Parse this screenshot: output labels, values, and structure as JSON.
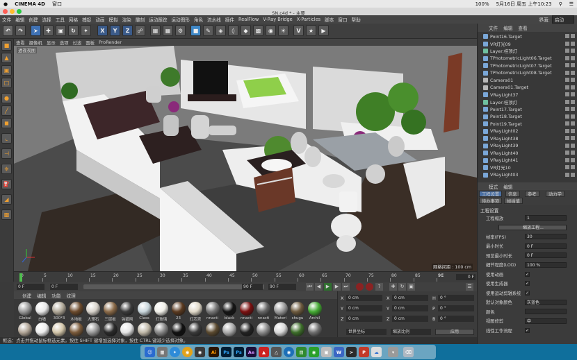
{
  "mac": {
    "app": "CINEMA 4D",
    "window_menu": "窗口",
    "battery": "100%",
    "date": "5月16日 周五 上午10:23"
  },
  "window": {
    "title": "SN.c4d * - 主要",
    "layout_label": "界面:",
    "layout_value": "启动"
  },
  "menu": [
    "文件",
    "编辑",
    "创建",
    "选择",
    "工具",
    "网格",
    "捕捉",
    "动画",
    "模拟",
    "渲染",
    "雕刻",
    "运动跟踪",
    "运动图形",
    "角色",
    "流水线",
    "插件",
    "RealFlow",
    "V-Ray Bridge",
    "X-Particles",
    "脚本",
    "窗口",
    "帮助"
  ],
  "toolbar": {
    "x": "X",
    "y": "Y",
    "z": "Z"
  },
  "viewport": {
    "menu": [
      "查看",
      "摄像机",
      "显示",
      "选项",
      "过滤",
      "面板",
      "ProRender"
    ],
    "label": "透视视图",
    "grid_info": "网格间距 : 100 cm"
  },
  "timeline": {
    "ticks": [
      "0",
      "5",
      "10",
      "15",
      "20",
      "25",
      "30",
      "35",
      "40",
      "45",
      "50",
      "55",
      "60",
      "65",
      "70",
      "75",
      "80",
      "85",
      "90"
    ],
    "end_marker": "9C",
    "frame_field": "0 F"
  },
  "playbar": {
    "start": "0 F",
    "current": "0 F",
    "end": "90 F",
    "max": "90 F"
  },
  "materials": {
    "menu": [
      "创建",
      "编辑",
      "功能",
      "纹理"
    ],
    "items": [
      {
        "label": "Global",
        "color": "#9a9a9a"
      },
      {
        "label": "白墙",
        "color": "#e8e8e8"
      },
      {
        "label": "300*3",
        "color": "#b0a898"
      },
      {
        "label": "木地板",
        "color": "#6b4a2c"
      },
      {
        "label": "大理石",
        "color": "#d8d3cb"
      },
      {
        "label": "三层板",
        "color": "#8a6a48"
      },
      {
        "label": "強碧网",
        "color": "#3b3b3b"
      },
      {
        "label": "Class",
        "color": "#c9d6dc"
      },
      {
        "label": "灯玻璃",
        "color": "#f0efe8"
      },
      {
        "label": "23",
        "color": "#5a3a20"
      },
      {
        "label": "灯芯壳",
        "color": "#e0d9c9"
      },
      {
        "label": "nnacti",
        "color": "#777777"
      },
      {
        "label": "black",
        "color": "#151515"
      },
      {
        "label": "nnacti",
        "color": "#7a1010"
      },
      {
        "label": "nnacti",
        "color": "#666666"
      },
      {
        "label": "Materi",
        "color": "#9b9b9b"
      },
      {
        "label": "shugu",
        "color": "#6d5a3e"
      },
      {
        "label": "Archil",
        "color": "#44aa33"
      },
      {
        "label": "",
        "color": "#b1a597"
      },
      {
        "label": "",
        "color": "#eeeeee"
      },
      {
        "label": "",
        "color": "#d1c4a8"
      },
      {
        "label": "",
        "color": "#7a5a3a"
      },
      {
        "label": "",
        "color": "#999999"
      },
      {
        "label": "",
        "color": "#2a2a2a"
      },
      {
        "label": "",
        "color": "#e5e5e5"
      },
      {
        "label": "",
        "color": "#c0b8a8"
      },
      {
        "label": "",
        "color": "#888888"
      },
      {
        "label": "",
        "color": "#101010"
      },
      {
        "label": "",
        "color": "#3a3a3a"
      },
      {
        "label": "",
        "color": "#5b4a30"
      },
      {
        "label": "",
        "color": "#aaaaaa"
      },
      {
        "label": "",
        "color": "#222222"
      },
      {
        "label": "",
        "color": "#8b8b8b"
      },
      {
        "label": "",
        "color": "#d8d8d8"
      },
      {
        "label": "",
        "color": "#3d6d2a"
      },
      {
        "label": "",
        "color": "#6f6f6f"
      }
    ]
  },
  "coords": {
    "rows": [
      {
        "a": "X",
        "av": "0 cm",
        "b": "X",
        "bv": "0 cm",
        "c": "H",
        "cv": "0 °"
      },
      {
        "a": "Y",
        "av": "0 cm",
        "b": "Y",
        "bv": "0 cm",
        "c": "P",
        "cv": "0 °"
      },
      {
        "a": "Z",
        "av": "0 cm",
        "b": "Z",
        "bv": "0 cm",
        "c": "B",
        "cv": "0 °"
      }
    ],
    "world": "世界坐标",
    "scale": "缩放比例",
    "apply": "应用"
  },
  "status": "框选：点击并拖动鼠标框选元素。按住 SHIFT 键增加选择对象，按住 CTRL 键减少选择对象。",
  "objects": {
    "menu": [
      "文件",
      "编辑",
      "查看"
    ],
    "items": [
      "Point16.Target",
      "VR灯光09",
      "Layer:桂顶灯",
      "TPhotometricLight06.Target",
      "TPhotometricLight07.Target",
      "TPhotometricLight08.Target",
      "Camera01",
      "Camera01.Target",
      "VRayLight37",
      "Layer:桂顶灯",
      "Point17.Target",
      "Point18.Target",
      "Point19.Target",
      "VRayLight02",
      "VRayLight38",
      "VRayLight39",
      "VRayLight40",
      "VRayLight41",
      "VR灯光10",
      "VRayLight03"
    ]
  },
  "attributes": {
    "menu": [
      "模式",
      "编辑"
    ],
    "tabs": [
      "工程设置",
      "信息",
      "参考",
      "动力学"
    ],
    "tabs2": [
      "待办事项",
      "帧插值"
    ],
    "section": "工程设置",
    "rows": [
      {
        "label": "工程缩放",
        "value": "1"
      },
      {
        "label": "",
        "value": "缩放工程..."
      },
      {
        "label": "帧率(FPS)",
        "value": "30"
      },
      {
        "label": "最小时长",
        "value": "0 F"
      },
      {
        "label": "预览最小时长",
        "value": "0 F"
      },
      {
        "label": "细节程度(LOD)",
        "value": "100 %"
      },
      {
        "label": "使用动画",
        "value": "✓"
      },
      {
        "label": "使用生成器",
        "value": "✓"
      },
      {
        "label": "使用运动剪辑系统",
        "value": "✓"
      },
      {
        "label": "默认对象颜色",
        "value": "灰蓝色"
      },
      {
        "label": "颜色",
        "value": ""
      },
      {
        "label": "视图修剪",
        "value": "中"
      },
      {
        "label": "线性工作流程",
        "value": "✓"
      }
    ]
  },
  "dock": {
    "ai": "Ai",
    "ps": "Ps",
    "ae": "Ae"
  },
  "colors": {
    "accent": "#f0a030",
    "dock_bg": "#0f6f9c",
    "selected": "#4a6fa3"
  }
}
